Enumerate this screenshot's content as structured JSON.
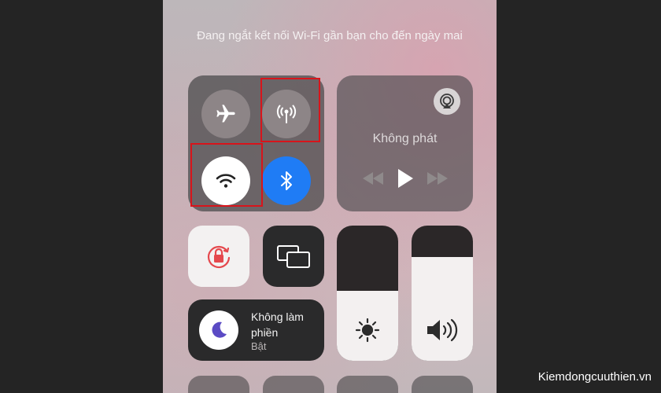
{
  "banner": {
    "text": "Đang ngắt kết nối Wi-Fi gần bạn cho đến ngày mai"
  },
  "connectivity": {
    "airplane": {
      "icon": "airplane-icon",
      "state": "off"
    },
    "cellular": {
      "icon": "antenna-icon",
      "state": "off"
    },
    "wifi": {
      "icon": "wifi-icon",
      "state": "disconnected-until-tomorrow"
    },
    "bluetooth": {
      "icon": "bluetooth-icon",
      "state": "on",
      "color": "#1f7cf5"
    }
  },
  "media": {
    "title": "Không phát",
    "airplay_icon": "airplay-icon",
    "controls": [
      "rewind-icon",
      "play-icon",
      "fast-forward-icon"
    ]
  },
  "toggles": {
    "orientation_lock": {
      "icon": "orientation-lock-icon",
      "accent": "#e5484d"
    },
    "screen_mirroring": {
      "icon": "screen-mirroring-icon"
    }
  },
  "focus": {
    "label": "Không làm phiền",
    "status": "Bật",
    "icon": "moon-icon",
    "accent": "#5b4bc4"
  },
  "brightness": {
    "icon": "sun-icon",
    "level": 0.52
  },
  "volume": {
    "icon": "speaker-icon",
    "level": 0.77
  },
  "highlight_color": "#d8141b",
  "watermark": "Kiemdongcuuthien.vn"
}
